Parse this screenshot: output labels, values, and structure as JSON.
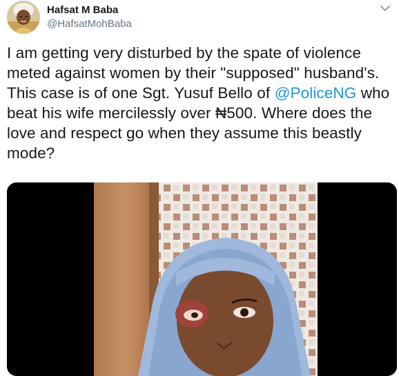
{
  "user": {
    "display_name": "Hafsat M Baba",
    "handle": "@HafsatMohBaba"
  },
  "tweet": {
    "line1": "I am getting very disturbed by the spate of violence",
    "line2": "meted against women by their \"supposed\" husband's.",
    "line3_pre": "This case is of one Sgt. Yusuf Bello of ",
    "mention": "@PoliceNG",
    "line3_post": " who",
    "line4": "beat his wife mercilessly over ₦500. Where does the",
    "line5": "love and respect go when they assume this beastly",
    "line6": "mode?"
  },
  "icons": {
    "menu": "chevron-down-icon"
  },
  "colors": {
    "text": "#14171a",
    "secondary": "#657786",
    "link": "#1b95e0"
  }
}
